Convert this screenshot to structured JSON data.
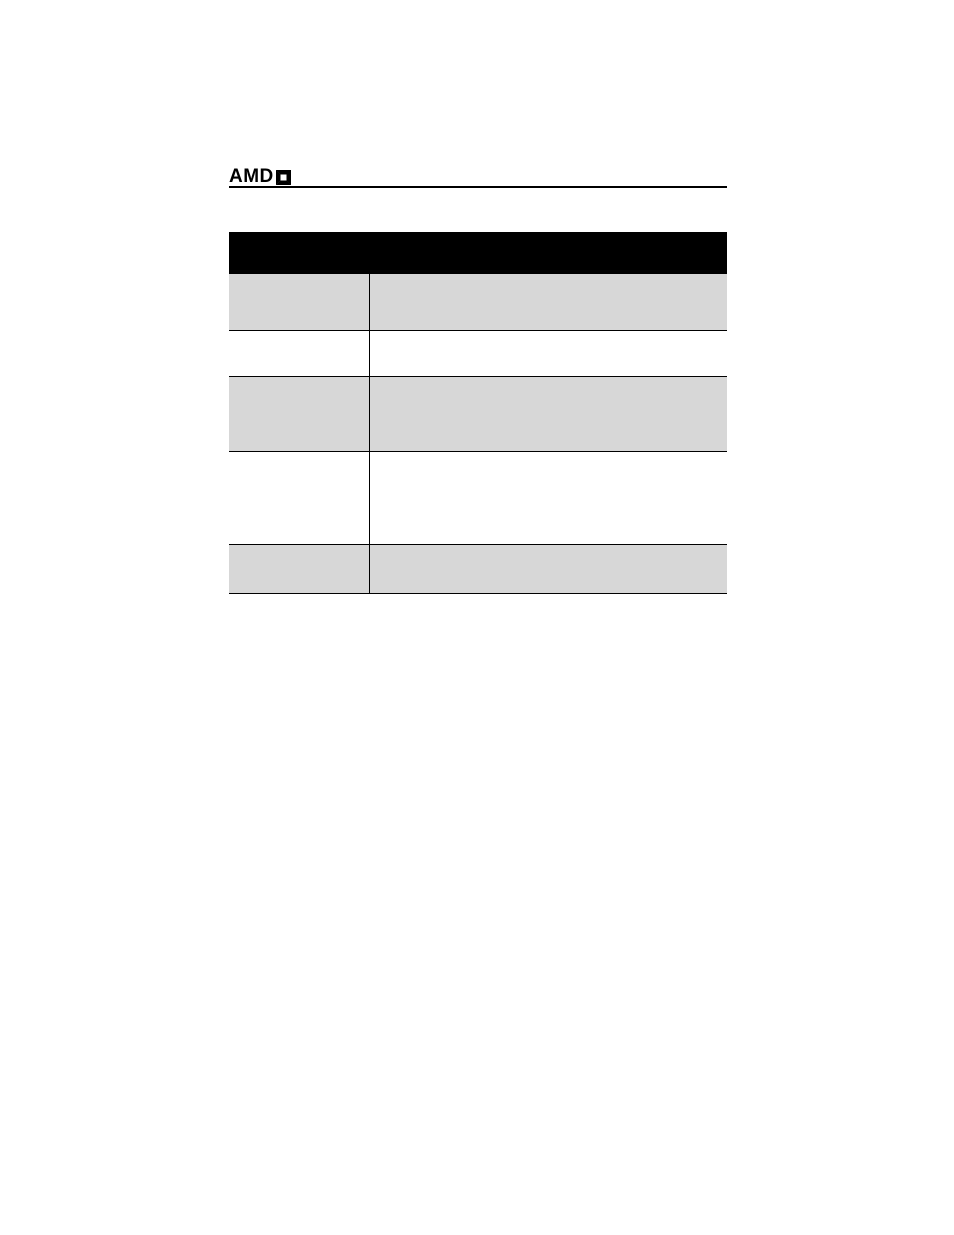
{
  "header": {
    "logo_text": "AMD",
    "logo_name": "amd-arrow-logo"
  },
  "table": {
    "caption": "",
    "columns": [
      "",
      ""
    ],
    "rows": [
      {
        "shaded": true,
        "height_class": "row-1",
        "left": "",
        "right": ""
      },
      {
        "shaded": false,
        "height_class": "row-2",
        "left": "",
        "right": ""
      },
      {
        "shaded": true,
        "height_class": "row-3",
        "left": "",
        "right": ""
      },
      {
        "shaded": false,
        "height_class": "row-4",
        "left": "",
        "right": ""
      },
      {
        "shaded": true,
        "height_class": "row-5",
        "left": "",
        "right": ""
      }
    ]
  }
}
